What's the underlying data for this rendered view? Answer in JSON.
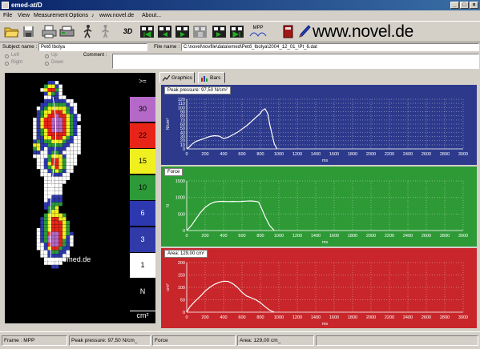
{
  "window": {
    "title": "emed-at/D",
    "min": "_",
    "max": "□",
    "close": "×"
  },
  "menu": {
    "file": "File",
    "view": "View",
    "measurement": "Measurement",
    "options": "Options",
    "link": "www.novel.de",
    "about": "About..."
  },
  "toolbar": {
    "icons": [
      "open-folder-icon",
      "save-disk-icon",
      "print-icon",
      "printer-icon",
      "walking-person-icon",
      "standing-person-icon",
      "3d-view-icon",
      "film-first-icon",
      "film-prev-icon",
      "film-play-icon",
      "film-stop-icon",
      "film-next-icon",
      "film-last-icon",
      "mpp-icon",
      "book-icon",
      "pen-icon"
    ],
    "label_3d": "3D",
    "label_mpp": "MPP",
    "brand": "www.novel.de"
  },
  "subject": {
    "subject_label": "Subject name :",
    "subject_value": "Pető Ibolya",
    "file_label": "File name :",
    "file_value": "C:\\novel\\novfile\\data\\emed\\Pető_Ibolya\\2004_12_01_\\Pt_6.dat",
    "comment_label": "Comment :",
    "comment_value": ""
  },
  "side": {
    "left": "Left",
    "right": "Right",
    "up": "Up",
    "down": "Down"
  },
  "foot": {
    "watermark": "www.emed.de"
  },
  "scale": {
    "top_label": ">=",
    "cells": [
      {
        "label": "30",
        "color": "#b469c8",
        "text": "#000"
      },
      {
        "label": "22",
        "color": "#e82418",
        "text": "#000"
      },
      {
        "label": "15",
        "color": "#f0f020",
        "text": "#000"
      },
      {
        "label": "10",
        "color": "#2c9a38",
        "text": "#000"
      },
      {
        "label": "6",
        "color": "#2c38b0",
        "text": "#fff"
      },
      {
        "label": "3",
        "color": "#303aa8",
        "text": "#fff"
      },
      {
        "label": "1",
        "color": "#ffffff",
        "text": "#000"
      },
      {
        "label": "N",
        "color": "#000000",
        "text": "#fff"
      }
    ],
    "unit": "cm²"
  },
  "tabs": {
    "graphics": "Graphics",
    "bars": "Bars"
  },
  "colors": {
    "pressure_bg": "#2d3a8c",
    "force_bg": "#2e9a36",
    "area_bg": "#c8262a"
  },
  "chart_data": [
    {
      "type": "line",
      "title": "Peak pressure: 97,50 N/cm²",
      "xlabel": "ms",
      "ylabel": "N/cm²",
      "xlim": [
        0,
        3000
      ],
      "ylim": [
        0,
        120
      ],
      "xticks": [
        0,
        200,
        400,
        600,
        800,
        1000,
        1200,
        1400,
        1600,
        1800,
        2000,
        2200,
        2400,
        2600,
        2800,
        3000
      ],
      "yticks": [
        0,
        10,
        20,
        30,
        40,
        50,
        60,
        70,
        80,
        90,
        100,
        110,
        120
      ],
      "x": [
        0,
        30,
        60,
        100,
        150,
        200,
        250,
        300,
        350,
        400,
        450,
        500,
        550,
        600,
        650,
        700,
        750,
        800,
        820,
        850,
        880,
        900,
        950,
        980
      ],
      "y": [
        0,
        5,
        12,
        18,
        22,
        26,
        30,
        32,
        31,
        25,
        28,
        34,
        40,
        48,
        56,
        66,
        76,
        86,
        93,
        97,
        85,
        60,
        12,
        0
      ]
    },
    {
      "type": "line",
      "title": "Force",
      "xlabel": "ms",
      "ylabel": "N",
      "xlim": [
        0,
        3000
      ],
      "ylim": [
        0,
        1500
      ],
      "xticks": [
        0,
        200,
        400,
        600,
        800,
        1000,
        1200,
        1400,
        1600,
        1800,
        2000,
        2200,
        2400,
        2600,
        2800,
        3000
      ],
      "yticks": [
        0,
        500,
        1000,
        1500
      ],
      "x": [
        0,
        50,
        100,
        150,
        200,
        250,
        300,
        350,
        400,
        450,
        500,
        550,
        600,
        650,
        700,
        750,
        780,
        800,
        850,
        900,
        950
      ],
      "y": [
        0,
        150,
        350,
        550,
        700,
        800,
        860,
        880,
        880,
        875,
        880,
        875,
        880,
        890,
        895,
        880,
        860,
        750,
        420,
        150,
        0
      ]
    },
    {
      "type": "line",
      "title": "Area: 129,00 cm²",
      "xlabel": "ms",
      "ylabel": "cm²",
      "xlim": [
        0,
        3000
      ],
      "ylim": [
        0,
        200
      ],
      "xticks": [
        0,
        200,
        400,
        600,
        800,
        1000,
        1200,
        1400,
        1600,
        1800,
        2000,
        2200,
        2400,
        2600,
        2800,
        3000
      ],
      "yticks": [
        0,
        50,
        100,
        150,
        200
      ],
      "x": [
        0,
        30,
        80,
        150,
        200,
        250,
        300,
        350,
        400,
        450,
        500,
        550,
        600,
        650,
        700,
        750,
        800,
        850,
        900,
        950
      ],
      "y": [
        0,
        20,
        40,
        65,
        85,
        100,
        112,
        120,
        125,
        124,
        115,
        100,
        80,
        65,
        58,
        50,
        38,
        22,
        8,
        0
      ]
    }
  ],
  "status": {
    "frame": "Frame : MPP",
    "peak": "Peak pressure: 97,50 N/cm_",
    "force": "Force",
    "area": "Area: 129,00 cm_"
  }
}
